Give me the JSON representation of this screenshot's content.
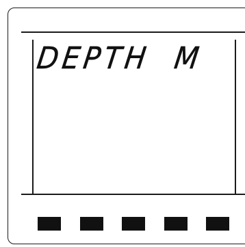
{
  "display": {
    "readout": "DEPTH  M"
  },
  "indicators": [
    {
      "id": 1,
      "state": "on"
    },
    {
      "id": 2,
      "state": "on"
    },
    {
      "id": 3,
      "state": "on"
    },
    {
      "id": 4,
      "state": "on"
    },
    {
      "id": 5,
      "state": "on"
    }
  ],
  "colors": {
    "segment_on": "#111111",
    "outline": "#1a1a1a",
    "background": "#ffffff"
  }
}
